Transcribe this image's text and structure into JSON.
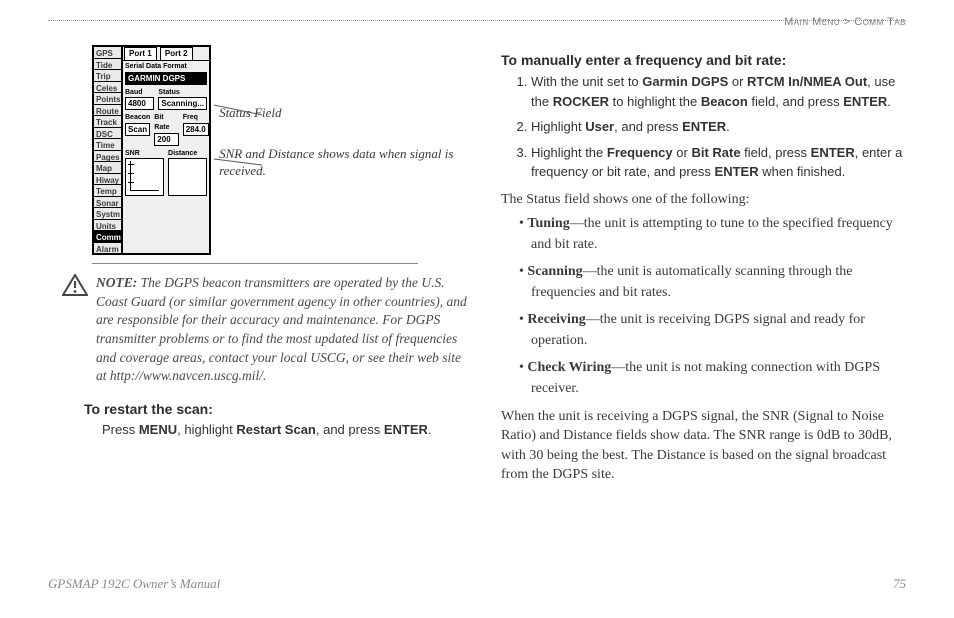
{
  "breadcrumb": {
    "a": "Main Menu",
    "sep": " > ",
    "b": "Comm Tab"
  },
  "device": {
    "sidebar": [
      "GPS",
      "Tide",
      "Trip",
      "Celes",
      "Points",
      "Route",
      "Track",
      "DSC",
      "Time",
      "Pages",
      "Map",
      "Hiway",
      "Temp",
      "Sonar",
      "Systm",
      "Units",
      "Comm",
      "Alarm"
    ],
    "sidebar_selected": "Comm",
    "tabs": [
      "Port 1",
      "Port 2"
    ],
    "sdf_label": "Serial Data Format",
    "sdf_value": "GARMIN DGPS",
    "baud_label": "Baud",
    "baud_value": "4800",
    "status_label": "Status",
    "status_value": "Scanning...",
    "beacon_label": "Beacon",
    "beacon_value": "Scan",
    "bitrate_label": "Bit Rate",
    "bitrate_value": "200",
    "freq_label": "Freq",
    "freq_value": "284.0",
    "snr_label": "SNR",
    "dist_label": "Distance"
  },
  "callouts": {
    "status": "Status Field",
    "snr": "SNR and Distance shows data when signal is received."
  },
  "note": {
    "label": "NOTE:",
    "body": " The DGPS beacon transmitters are operated by the U.S. Coast Guard (or similar government agency in other countries), and are responsible for their accuracy and maintenance. For DGPS transmitter problems or to find the most updated list of frequencies and coverage areas, contact your local USCG, or see their web site at http://www.navcen.uscg.mil/."
  },
  "restart": {
    "heading": "To restart the scan:",
    "line_a": "Press ",
    "line_b": "MENU",
    "line_c": ", highlight ",
    "line_d": "Restart Scan",
    "line_e": ", and press ",
    "line_f": "ENTER",
    "line_g": "."
  },
  "manual": {
    "heading": "To manually enter a frequency and bit rate:",
    "s1a": "With the unit set to ",
    "s1b": "Garmin DGPS",
    "s1c": " or ",
    "s1d": "RTCM In/NMEA Out",
    "s1e": ", use the ",
    "s1f": "ROCKER",
    "s1g": " to highlight the ",
    "s1h": "Beacon",
    "s1i": " field, and press ",
    "s1j": "ENTER",
    "s1k": ".",
    "s2a": "Highlight ",
    "s2b": "User",
    "s2c": ", and press ",
    "s2d": "ENTER",
    "s2e": ".",
    "s3a": "Highlight the ",
    "s3b": "Frequency",
    "s3c": " or ",
    "s3d": "Bit Rate",
    "s3e": " field, press ",
    "s3f": "ENTER",
    "s3g": ", enter a frequency or bit rate, and press ",
    "s3h": "ENTER",
    "s3i": " when finished."
  },
  "status_intro": "The Status field shows one of the following:",
  "statuses": {
    "t_b": "Tuning",
    "t_r": "—the unit is attempting to tune to the specified frequency and bit rate.",
    "s_b": "Scanning",
    "s_r": "—the unit is automatically scanning through the frequencies and bit rates.",
    "r_b": "Receiving",
    "r_r": "—the unit is receiving DGPS signal and ready for operation.",
    "c_b": "Check Wiring",
    "c_r": "—the unit is not making connection with DGPS receiver."
  },
  "closing": "When the unit is receiving a DGPS signal, the SNR (Signal to Noise Ratio) and Distance fields show data. The SNR range is 0dB to 30dB, with 30 being the best. The Distance is based on the signal broadcast from the DGPS site.",
  "footer": {
    "left": "GPSMAP 192C Owner’s Manual",
    "right": "75"
  }
}
